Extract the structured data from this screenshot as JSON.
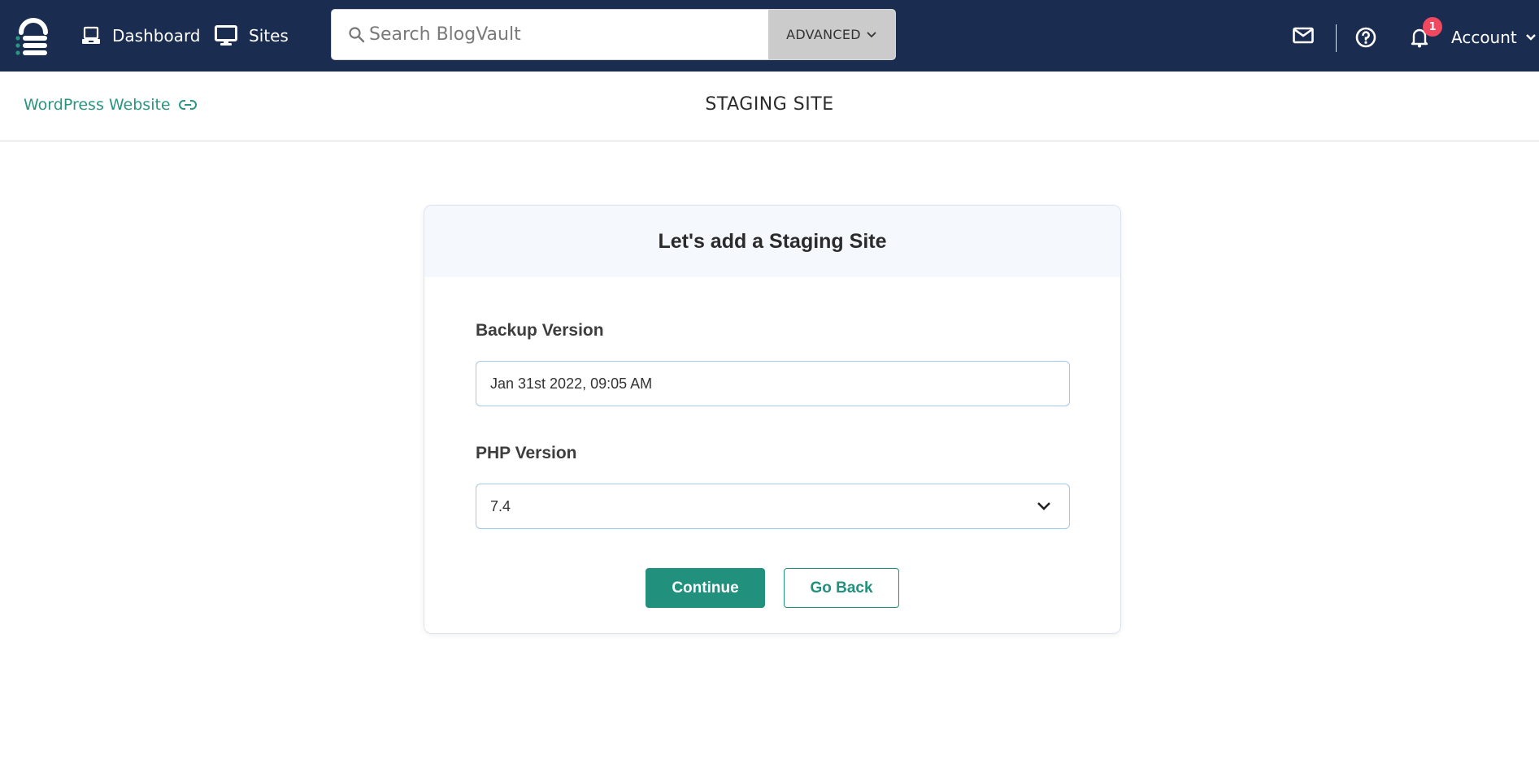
{
  "topbar": {
    "nav": [
      {
        "label": "Dashboard",
        "icon": "laptop-icon"
      },
      {
        "label": "Sites",
        "icon": "monitor-icon"
      }
    ],
    "search": {
      "placeholder": "Search BlogVault",
      "value": "",
      "advanced_label": "ADVANCED"
    },
    "notifications": {
      "count": "1"
    },
    "account_label": "Account"
  },
  "subheader": {
    "site_link": "WordPress Website",
    "page_title": "STAGING SITE"
  },
  "card": {
    "title": "Let's add a Staging Site",
    "backup_version": {
      "label": "Backup Version",
      "value": "Jan 31st 2022, 09:05 AM"
    },
    "php_version": {
      "label": "PHP Version",
      "value": "7.4"
    },
    "continue_label": "Continue",
    "back_label": "Go Back"
  },
  "colors": {
    "topbar_bg": "#1a2d50",
    "accent": "#21907c",
    "badge": "#f0485f",
    "card_header_bg": "#f5f8fc",
    "field_border": "#a8c5ea"
  }
}
